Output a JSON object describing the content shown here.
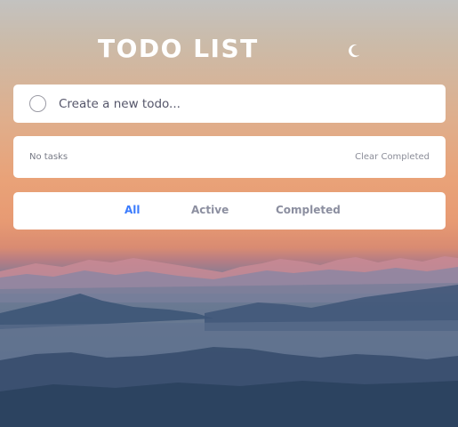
{
  "header": {
    "title": "TODO LIST",
    "theme_icon": "moon-icon"
  },
  "new_todo": {
    "placeholder": "Create a new todo...",
    "checkbox_icon": "circle-checkbox-icon"
  },
  "list": {
    "empty_text": "No tasks",
    "clear_label": "Clear Completed"
  },
  "filters": {
    "all": "All",
    "active": "Active",
    "completed": "Completed",
    "selected": "All"
  },
  "colors": {
    "accent": "#3a7bfd",
    "card": "#ffffff",
    "muted_text": "#8c8fa0"
  }
}
